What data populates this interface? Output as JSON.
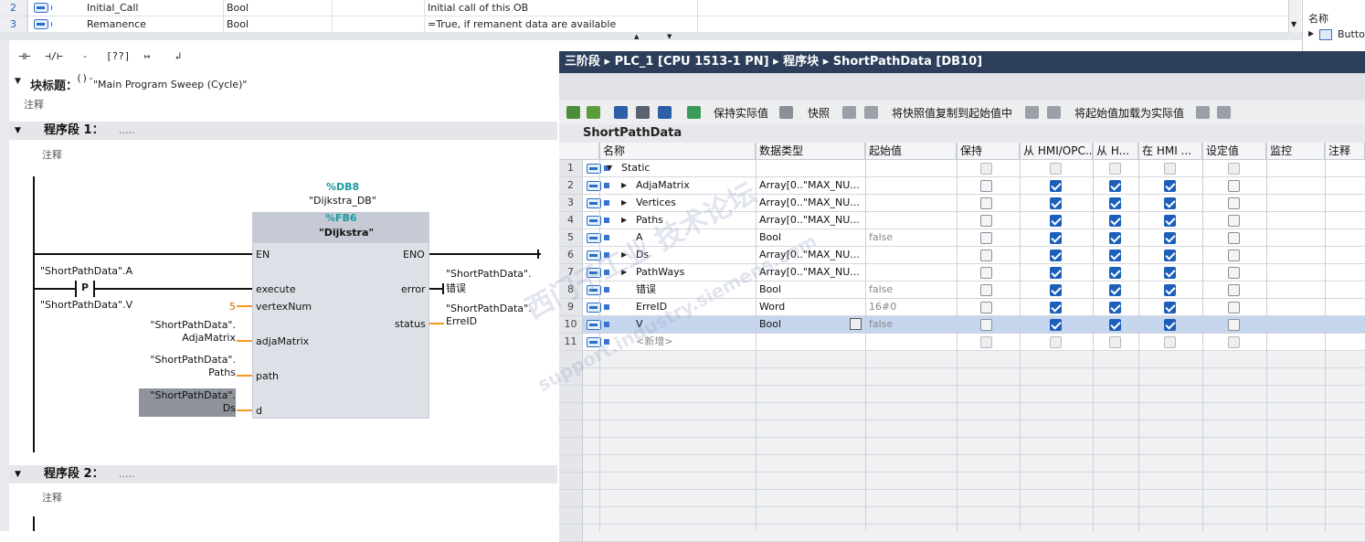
{
  "interface_table": {
    "rows": [
      {
        "num": "2",
        "name": "Initial_Call",
        "type": "Bool",
        "comment": "Initial call of this OB"
      },
      {
        "num": "3",
        "name": "Remanence",
        "type": "Bool",
        "comment": "=True, if remanent data are available"
      }
    ]
  },
  "library_panel": {
    "header": "名称",
    "item": "Butto"
  },
  "ladder_toolbar": {
    "buttons": [
      {
        "glyph": "⊣⊢",
        "name": "no-contact"
      },
      {
        "glyph": "⊣/⊢",
        "name": "nc-contact"
      },
      {
        "glyph": "-()-",
        "name": "coil"
      },
      {
        "glyph": "[??]",
        "name": "empty-box"
      },
      {
        "glyph": "↦",
        "name": "open-branch"
      },
      {
        "glyph": "↲",
        "name": "close-branch"
      }
    ]
  },
  "block_title": {
    "label": "块标题：",
    "value": "\"Main Program Sweep (Cycle)\"",
    "comment": "注释"
  },
  "network1": {
    "label": "程序段 1：",
    "dots": ".....",
    "comment": "注释",
    "db_number": "%DB8",
    "db_name": "\"Dijkstra_DB\"",
    "fb_number": "%FB6",
    "fb_name": "\"Dijkstra\"",
    "pins_in": [
      "EN",
      "execute",
      "vertexNum",
      "adjaMatrix",
      "path",
      "d"
    ],
    "pins_out": [
      "ENO",
      "error",
      "status"
    ],
    "contact_var_top": "\"ShortPathData\".A",
    "contact_type": "P",
    "contact_var_bottom": "\"ShortPathData\".V",
    "vertex_value": "5",
    "adja_var_1": "\"ShortPathData\".",
    "adja_var_2": "AdjaMatrix",
    "path_var_1": "\"ShortPathData\".",
    "path_var_2": "Paths",
    "d_var_1": "\"ShortPathData\".",
    "d_var_2": "Ds",
    "error_var_1": "\"ShortPathData\".",
    "error_var_2": "错误",
    "status_var_1": "\"ShortPathData\".",
    "status_var_2": "ErreID"
  },
  "network2": {
    "label": "程序段 2：",
    "dots": ".....",
    "comment": "注释"
  },
  "db_editor": {
    "title": "三阶段  ▸  PLC_1 [CPU 1513-1 PN]  ▸  程序块  ▸  ShortPathData [DB10]",
    "toolbar": {
      "keep_actual": "保持实际值",
      "snapshot": "快照",
      "copy_snapshot": "将快照值复制到起始值中",
      "load_start": "将起始值加载为实际值"
    },
    "db_name": "ShortPathData",
    "columns": [
      "名称",
      "数据类型",
      "起始值",
      "保持",
      "从 HMI/OPC...",
      "从 H...",
      "在 HMI ...",
      "设定值",
      "监控",
      "注释"
    ],
    "rows": [
      {
        "num": "1",
        "name": "Static",
        "type": "",
        "start": "",
        "expand": "▼",
        "indent": 0,
        "retain": false,
        "hmi1": false,
        "hmi2": false,
        "hmi3": false,
        "setp": false,
        "dis": true
      },
      {
        "num": "2",
        "name": "AdjaMatrix",
        "type": "Array[0..\"MAX_NU...",
        "start": "",
        "expand": "▶",
        "indent": 1,
        "retain": false,
        "hmi1": true,
        "hmi2": true,
        "hmi3": true,
        "setp": false,
        "dis": false
      },
      {
        "num": "3",
        "name": "Vertices",
        "type": "Array[0..\"MAX_NU...",
        "start": "",
        "expand": "▶",
        "indent": 1,
        "retain": false,
        "hmi1": true,
        "hmi2": true,
        "hmi3": true,
        "setp": false,
        "dis": false
      },
      {
        "num": "4",
        "name": "Paths",
        "type": "Array[0..\"MAX_NU...",
        "start": "",
        "expand": "▶",
        "indent": 1,
        "retain": false,
        "hmi1": true,
        "hmi2": true,
        "hmi3": true,
        "setp": false,
        "dis": false
      },
      {
        "num": "5",
        "name": "A",
        "type": "Bool",
        "start": "false",
        "expand": "",
        "indent": 1,
        "retain": false,
        "hmi1": true,
        "hmi2": true,
        "hmi3": true,
        "setp": false,
        "dis": false
      },
      {
        "num": "6",
        "name": "Ds",
        "type": "Array[0..\"MAX_NU...",
        "start": "",
        "expand": "▶",
        "indent": 1,
        "retain": false,
        "hmi1": true,
        "hmi2": true,
        "hmi3": true,
        "setp": false,
        "dis": false
      },
      {
        "num": "7",
        "name": "PathWays",
        "type": "Array[0..\"MAX_NU...",
        "start": "",
        "expand": "▶",
        "indent": 1,
        "retain": false,
        "hmi1": true,
        "hmi2": true,
        "hmi3": true,
        "setp": false,
        "dis": false
      },
      {
        "num": "8",
        "name": "错误",
        "type": "Bool",
        "start": "false",
        "expand": "",
        "indent": 1,
        "retain": false,
        "hmi1": true,
        "hmi2": true,
        "hmi3": true,
        "setp": false,
        "dis": false
      },
      {
        "num": "9",
        "name": "ErreID",
        "type": "Word",
        "start": "16#0",
        "expand": "",
        "indent": 1,
        "retain": false,
        "hmi1": true,
        "hmi2": true,
        "hmi3": true,
        "setp": false,
        "dis": false
      },
      {
        "num": "10",
        "name": "V",
        "type": "Bool",
        "start": "false",
        "expand": "",
        "indent": 1,
        "retain": false,
        "hmi1": true,
        "hmi2": true,
        "hmi3": true,
        "setp": false,
        "dis": false,
        "selected": true
      },
      {
        "num": "11",
        "name": "<新增>",
        "type": "",
        "start": "",
        "expand": "",
        "indent": 1,
        "retain": false,
        "hmi1": false,
        "hmi2": false,
        "hmi3": false,
        "setp": false,
        "dis": true
      }
    ]
  },
  "watermark": {
    "line1": "西门子工业 技术论坛",
    "line2": "support.industry.siemens.com"
  }
}
